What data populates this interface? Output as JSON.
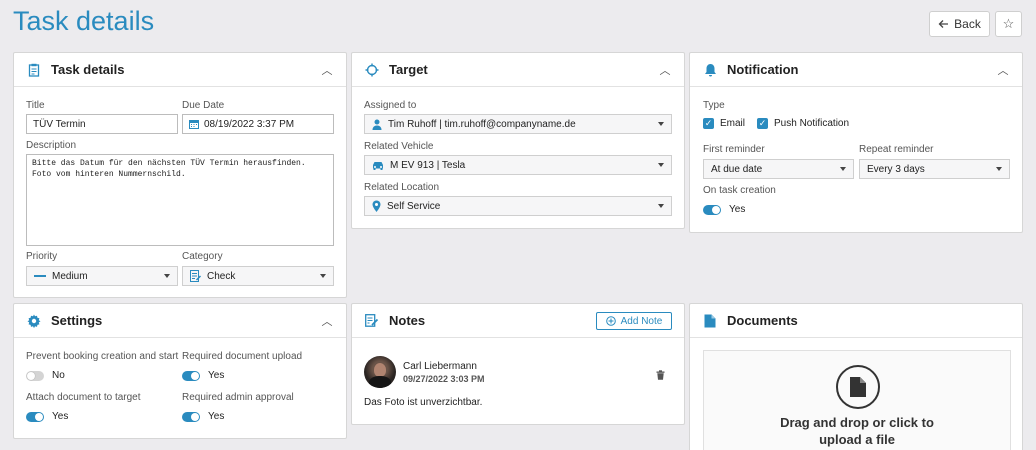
{
  "page": {
    "title": "Task details"
  },
  "header": {
    "back_label": "Back",
    "back_icon": "arrow-left-icon",
    "star_icon": "star-icon"
  },
  "colors": {
    "accent": "#2a8bbf",
    "background": "#ecebee"
  },
  "task_details": {
    "title": "Task details",
    "title_label": "Title",
    "title_value": "TÜV Termin",
    "due_date_label": "Due Date",
    "due_date_value": "08/19/2022 3:37 PM",
    "description_label": "Description",
    "description_value": "Bitte das Datum für den nächsten TÜV Termin herausfinden. Foto vom hinteren Nummernschild.",
    "priority_label": "Priority",
    "priority_value": "Medium",
    "category_label": "Category",
    "category_value": "Check"
  },
  "target": {
    "title": "Target",
    "assigned_label": "Assigned to",
    "assigned_value": "Tim Ruhoff | tim.ruhoff@companyname.de",
    "vehicle_label": "Related Vehicle",
    "vehicle_value": "M EV 913 | Tesla",
    "location_label": "Related Location",
    "location_value": "Self Service"
  },
  "notification": {
    "title": "Notification",
    "type_label": "Type",
    "email_label": "Email",
    "email_checked": true,
    "push_label": "Push Notification",
    "push_checked": true,
    "first_reminder_label": "First reminder",
    "first_reminder_value": "At due date",
    "repeat_reminder_label": "Repeat reminder",
    "repeat_reminder_value": "Every 3 days",
    "on_creation_label": "On task creation",
    "on_creation_value": "Yes"
  },
  "settings": {
    "title": "Settings",
    "prevent_label": "Prevent booking creation and start",
    "prevent_value": "No",
    "doc_upload_label": "Required document upload",
    "doc_upload_value": "Yes",
    "attach_label": "Attach document to target",
    "attach_value": "Yes",
    "admin_label": "Required admin approval",
    "admin_value": "Yes"
  },
  "notes": {
    "title": "Notes",
    "add_label": "Add Note",
    "items": [
      {
        "author": "Carl Liebermann",
        "date": "09/27/2022 3:03 PM",
        "text": "Das Foto ist unverzichtbar."
      }
    ]
  },
  "documents": {
    "title": "Documents",
    "dropzone_line1": "Drag and drop or click to",
    "dropzone_line2": "upload a file"
  }
}
